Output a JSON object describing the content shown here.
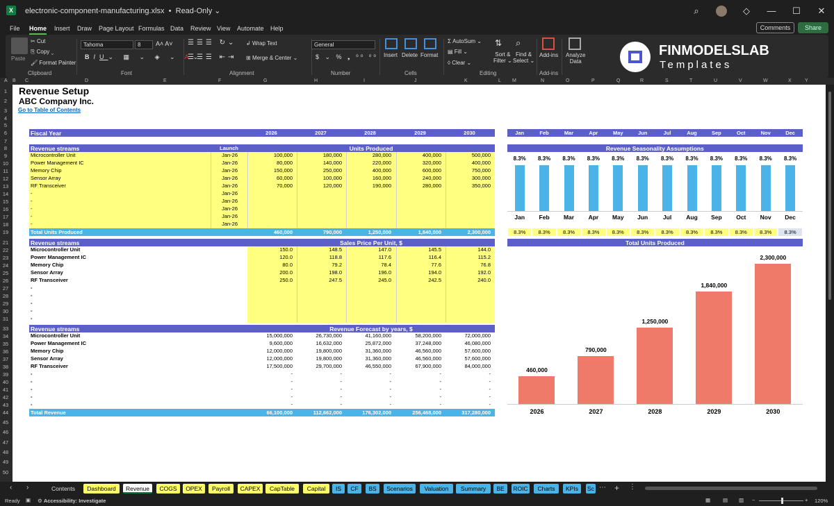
{
  "window": {
    "file_name": "electronic-component-manufacturing.xlsx",
    "mode": "Read-Only"
  },
  "menu": [
    "File",
    "Home",
    "Insert",
    "Draw",
    "Page Layout",
    "Formulas",
    "Data",
    "Review",
    "View",
    "Automate",
    "Help"
  ],
  "menu_active": "Home",
  "toolbar": {
    "comments": "Comments",
    "share": "Share"
  },
  "ribbon": {
    "paste": "Paste",
    "cut": "Cut",
    "copy": "Copy",
    "format_painter": "Format Painter",
    "clipboard": "Clipboard",
    "font_name": "Tahoma",
    "font_size": "8",
    "font": "Font",
    "wrap_text": "Wrap Text",
    "merge_center": "Merge & Center",
    "alignment": "Alignment",
    "number_format": "General",
    "number": "Number",
    "insert": "Insert",
    "delete": "Delete",
    "format": "Format",
    "cells": "Cells",
    "autosum": "AutoSum",
    "fill": "Fill",
    "clear": "Clear",
    "sort_filter_1": "Sort &",
    "sort_filter_2": "Filter",
    "find_select_1": "Find &",
    "find_select_2": "Select",
    "editing": "Editing",
    "addins": "Add-ins",
    "analyze_1": "Analyze",
    "analyze_2": "Data"
  },
  "logo": {
    "line1": "FINMODELSLAB",
    "line2": "Templates"
  },
  "columns": [
    "A",
    "B",
    "C",
    "D",
    "E",
    "F",
    "G",
    "H",
    "I",
    "J",
    "K",
    "L",
    "M",
    "N",
    "O",
    "P",
    "Q",
    "R",
    "S",
    "T",
    "U",
    "V",
    "W",
    "X",
    "Y"
  ],
  "rows": [
    "1",
    "2",
    "3",
    "4",
    "5",
    "6",
    "7",
    "8",
    "9",
    "10",
    "11",
    "12",
    "13",
    "14",
    "15",
    "16",
    "17",
    "18",
    "19",
    "21",
    "22",
    "23",
    "24",
    "25",
    "26",
    "27",
    "28",
    "29",
    "30",
    "31",
    "33",
    "34",
    "35",
    "36",
    "37",
    "38",
    "39",
    "40",
    "41",
    "42",
    "43",
    "44",
    "45",
    "46",
    "47",
    "48",
    "49",
    "50"
  ],
  "sheet": {
    "title": "Revenue Setup",
    "company": "ABC Company Inc.",
    "link": "Go to Table of Contents",
    "fiscal_year": "Fiscal Year",
    "years": [
      "2026",
      "2027",
      "2028",
      "2029",
      "2030"
    ],
    "months": [
      "Jan",
      "Feb",
      "Mar",
      "Apr",
      "May",
      "Jun",
      "Jul",
      "Aug",
      "Sep",
      "Oct",
      "Nov",
      "Dec"
    ],
    "rs_label": "Revenue streams",
    "launch_label": "Launch",
    "units_title": "Units Produced",
    "units_rows": [
      {
        "name": "Microcontroller Unit",
        "launch": "Jan-26",
        "v": [
          "100,000",
          "180,000",
          "280,000",
          "400,000",
          "500,000"
        ]
      },
      {
        "name": "Power Management IC",
        "launch": "Jan-26",
        "v": [
          "80,000",
          "140,000",
          "220,000",
          "320,000",
          "400,000"
        ]
      },
      {
        "name": "Memory Chip",
        "launch": "Jan-26",
        "v": [
          "150,000",
          "250,000",
          "400,000",
          "600,000",
          "750,000"
        ]
      },
      {
        "name": "Sensor Array",
        "launch": "Jan-26",
        "v": [
          "60,000",
          "100,000",
          "160,000",
          "240,000",
          "300,000"
        ]
      },
      {
        "name": "RF Transceiver",
        "launch": "Jan-26",
        "v": [
          "70,000",
          "120,000",
          "190,000",
          "280,000",
          "350,000"
        ]
      },
      {
        "name": "-",
        "launch": "Jan-26",
        "v": [
          "",
          "",
          "",
          "",
          ""
        ]
      },
      {
        "name": "-",
        "launch": "Jan-26",
        "v": [
          "",
          "",
          "",
          "",
          ""
        ]
      },
      {
        "name": "-",
        "launch": "Jan-26",
        "v": [
          "",
          "",
          "",
          "",
          ""
        ]
      },
      {
        "name": "-",
        "launch": "Jan-26",
        "v": [
          "",
          "",
          "",
          "",
          ""
        ]
      },
      {
        "name": "-",
        "launch": "Jan-26",
        "v": [
          "",
          "",
          "",
          "",
          ""
        ]
      }
    ],
    "total_units_label": "Total Units Produced",
    "total_units": [
      "460,000",
      "790,000",
      "1,250,000",
      "1,840,000",
      "2,300,000"
    ],
    "price_title": "Sales Price Per Unit, $",
    "price_rows": [
      {
        "name": "Microcontroller Unit",
        "v": [
          "150.0",
          "148.5",
          "147.0",
          "145.5",
          "144.0"
        ]
      },
      {
        "name": "Power Management IC",
        "v": [
          "120.0",
          "118.8",
          "117.6",
          "116.4",
          "115.2"
        ]
      },
      {
        "name": "Memory Chip",
        "v": [
          "80.0",
          "79.2",
          "78.4",
          "77.6",
          "76.8"
        ]
      },
      {
        "name": "Sensor Array",
        "v": [
          "200.0",
          "198.0",
          "196.0",
          "194.0",
          "192.0"
        ]
      },
      {
        "name": "RF Transceiver",
        "v": [
          "250.0",
          "247.5",
          "245.0",
          "242.5",
          "240.0"
        ]
      },
      {
        "name": "-",
        "v": [
          "",
          "",
          "",
          "",
          ""
        ]
      },
      {
        "name": "-",
        "v": [
          "",
          "",
          "",
          "",
          ""
        ]
      },
      {
        "name": "-",
        "v": [
          "",
          "",
          "",
          "",
          ""
        ]
      },
      {
        "name": "-",
        "v": [
          "",
          "",
          "",
          "",
          ""
        ]
      },
      {
        "name": "-",
        "v": [
          "",
          "",
          "",
          "",
          ""
        ]
      }
    ],
    "rev_title": "Revenue Forecast by years, $",
    "rev_rows": [
      {
        "name": "Microcontroller Unit",
        "v": [
          "15,000,000",
          "26,730,000",
          "41,160,000",
          "58,200,000",
          "72,000,000"
        ]
      },
      {
        "name": "Power Management IC",
        "v": [
          "9,600,000",
          "16,632,000",
          "25,872,000",
          "37,248,000",
          "46,080,000"
        ]
      },
      {
        "name": "Memory Chip",
        "v": [
          "12,000,000",
          "19,800,000",
          "31,360,000",
          "46,560,000",
          "57,600,000"
        ]
      },
      {
        "name": "Sensor Array",
        "v": [
          "12,000,000",
          "19,800,000",
          "31,360,000",
          "46,560,000",
          "57,600,000"
        ]
      },
      {
        "name": "RF Transceiver",
        "v": [
          "17,500,000",
          "29,700,000",
          "46,550,000",
          "67,900,000",
          "84,000,000"
        ]
      },
      {
        "name": "-",
        "v": [
          "-",
          "-",
          "-",
          "-",
          "-"
        ]
      },
      {
        "name": "-",
        "v": [
          "-",
          "-",
          "-",
          "-",
          "-"
        ]
      },
      {
        "name": "-",
        "v": [
          "-",
          "-",
          "-",
          "-",
          "-"
        ]
      },
      {
        "name": "-",
        "v": [
          "-",
          "-",
          "-",
          "-",
          "-"
        ]
      },
      {
        "name": "-",
        "v": [
          "-",
          "-",
          "-",
          "-",
          "-"
        ]
      }
    ],
    "total_rev_label": "Total Revenue",
    "total_rev": [
      "66,100,000",
      "112,662,000",
      "176,302,000",
      "256,468,000",
      "317,280,000"
    ],
    "seasonality_title": "Revenue Seasonality Assumptions",
    "seasonality_pct": [
      "8.3%",
      "8.3%",
      "8.3%",
      "8.3%",
      "8.3%",
      "8.3%",
      "8.3%",
      "8.3%",
      "8.3%",
      "8.3%",
      "8.3%",
      "8.3%"
    ],
    "units_chart_title": "Total Units Produced"
  },
  "chart_data": [
    {
      "type": "bar",
      "title": "Revenue Seasonality Assumptions",
      "categories": [
        "Jan",
        "Feb",
        "Mar",
        "Apr",
        "May",
        "Jun",
        "Jul",
        "Aug",
        "Sep",
        "Oct",
        "Nov",
        "Dec"
      ],
      "values": [
        8.3,
        8.3,
        8.3,
        8.3,
        8.3,
        8.3,
        8.3,
        8.3,
        8.3,
        8.3,
        8.3,
        8.3
      ],
      "data_labels": [
        "8.3%",
        "8.3%",
        "8.3%",
        "8.3%",
        "8.3%",
        "8.3%",
        "8.3%",
        "8.3%",
        "8.3%",
        "8.3%",
        "8.3%",
        "8.3%"
      ],
      "color": "#4ab3e8",
      "grid": false,
      "legend": "none"
    },
    {
      "type": "bar",
      "title": "Total Units Produced",
      "categories": [
        "2026",
        "2027",
        "2028",
        "2029",
        "2030"
      ],
      "values": [
        460000,
        790000,
        1250000,
        1840000,
        2300000
      ],
      "data_labels": [
        "460,000",
        "790,000",
        "1,250,000",
        "1,840,000",
        "2,300,000"
      ],
      "color": "#f07a6a",
      "grid": false,
      "legend": "none"
    }
  ],
  "sheet_tabs": [
    {
      "label": "Contents",
      "color": "none"
    },
    {
      "label": "Dashboard",
      "color": "#ffff66"
    },
    {
      "label": "Revenue",
      "color": "active"
    },
    {
      "label": "COGS",
      "color": "#ffff66"
    },
    {
      "label": "OPEX",
      "color": "#ffff66"
    },
    {
      "label": "Payroll",
      "color": "#ffff66"
    },
    {
      "label": "CAPEX",
      "color": "#ffff66"
    },
    {
      "label": "CapTable",
      "color": "#ffff66"
    },
    {
      "label": "Capital",
      "color": "#ffff66"
    },
    {
      "label": "IS",
      "color": "#4ab3e8"
    },
    {
      "label": "CF",
      "color": "#4ab3e8"
    },
    {
      "label": "BS",
      "color": "#4ab3e8"
    },
    {
      "label": "Scenarios",
      "color": "#4ab3e8"
    },
    {
      "label": "Valuation",
      "color": "#4ab3e8"
    },
    {
      "label": "Summary",
      "color": "#4ab3e8"
    },
    {
      "label": "BE",
      "color": "#4ab3e8"
    },
    {
      "label": "ROIC",
      "color": "#4ab3e8"
    },
    {
      "label": "Charts",
      "color": "#4ab3e8"
    },
    {
      "label": "KPIs",
      "color": "#4ab3e8"
    },
    {
      "label": "Sc",
      "color": "#4ab3e8"
    }
  ],
  "status": {
    "ready": "Ready",
    "accessibility": "Accessibility: Investigate",
    "zoom": "120%"
  }
}
